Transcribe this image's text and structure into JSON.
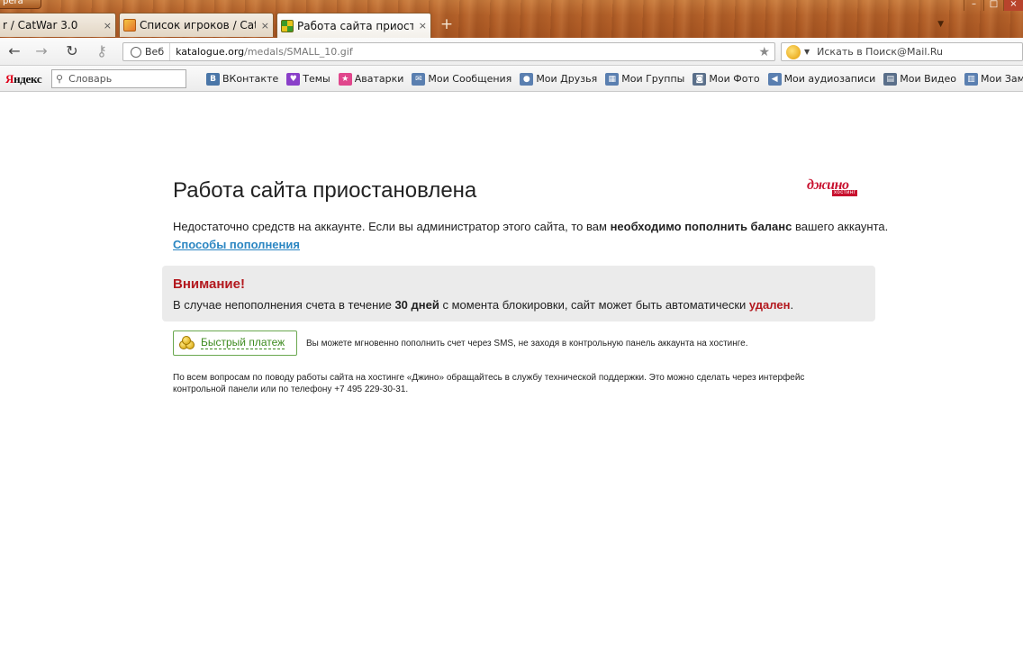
{
  "browser": {
    "menu_label": "pera",
    "tabs": [
      {
        "title": "r / CatWar 3.0",
        "close": "×"
      },
      {
        "title": "Список игроков / CatW...",
        "close": "×"
      },
      {
        "title": "Работа сайта приостан...",
        "close": "×"
      }
    ],
    "new_tab": "+",
    "window_controls": {
      "minimize": "–",
      "maximize": "□",
      "close": "×"
    }
  },
  "navbar": {
    "back": "←",
    "forward": "→",
    "reload": "↻",
    "key": "⚷",
    "web_badge": "Веб",
    "url_host": "katalogue.org",
    "url_path": "/medals/SMALL_10.gif",
    "bookmark_star": "★",
    "search_placeholder": "Искать в Поиск@Mail.Ru"
  },
  "yandex_toolbar": {
    "logo_first": "Я",
    "logo_rest": "ндекс",
    "search_placeholder": "Словарь",
    "links": [
      {
        "label": "ВКонтакте",
        "icon": "vk-icon",
        "color": "#4a76a8",
        "glyph": "B"
      },
      {
        "label": "Темы",
        "icon": "heart-icon",
        "color": "#8a3fc9",
        "glyph": "♥"
      },
      {
        "label": "Аватарки",
        "icon": "star-icon",
        "color": "#e0468c",
        "glyph": "★"
      },
      {
        "label": "Мои Сообщения",
        "icon": "envelope-icon",
        "color": "#5a7fb0",
        "glyph": "✉"
      },
      {
        "label": "Мои Друзья",
        "icon": "person-icon",
        "color": "#5a7fb0",
        "glyph": "●"
      },
      {
        "label": "Мои Группы",
        "icon": "group-icon",
        "color": "#5a7fb0",
        "glyph": "▦"
      },
      {
        "label": "Мои Фото",
        "icon": "camera-icon",
        "color": "#5a6f8a",
        "glyph": "◙"
      },
      {
        "label": "Мои аудиозаписи",
        "icon": "speaker-icon",
        "color": "#5a7fb0",
        "glyph": "◀"
      },
      {
        "label": "Мои Видео",
        "icon": "film-icon",
        "color": "#5a6f8a",
        "glyph": "▤"
      },
      {
        "label": "Мои Заметки",
        "icon": "notes-icon",
        "color": "#5a7fb0",
        "glyph": "▥"
      }
    ]
  },
  "page": {
    "title": "Работа сайта приостановлена",
    "logo_word": "джино",
    "logo_sub": "хостинг",
    "lead_before": "Недостаточно средств на аккаунте. Если вы администратор этого сайта, то вам ",
    "lead_bold": "необходимо пополнить баланс",
    "lead_after": " вашего аккаунта.",
    "pay_methods_link": "Способы пополнения",
    "warning_title": "Внимание!",
    "warning_before": "В случае непополнения счета в течение ",
    "warning_bold": "30 дней",
    "warning_middle": " с момента блокировки, сайт может быть автоматически ",
    "warning_red": "удален",
    "warning_end": ".",
    "fastpay_label": "Быстрый платеж",
    "fastpay_note": "Вы можете мгновенно пополнить счет через SMS, не заходя в контрольную панель аккаунта на хостинге.",
    "support_text": "По всем вопросам по поводу работы сайта на хостинге «Джино» обращайтесь в службу технической поддержки. Это можно сделать через интерфейс контрольной панели или по телефону +7 495 229-30-31."
  }
}
